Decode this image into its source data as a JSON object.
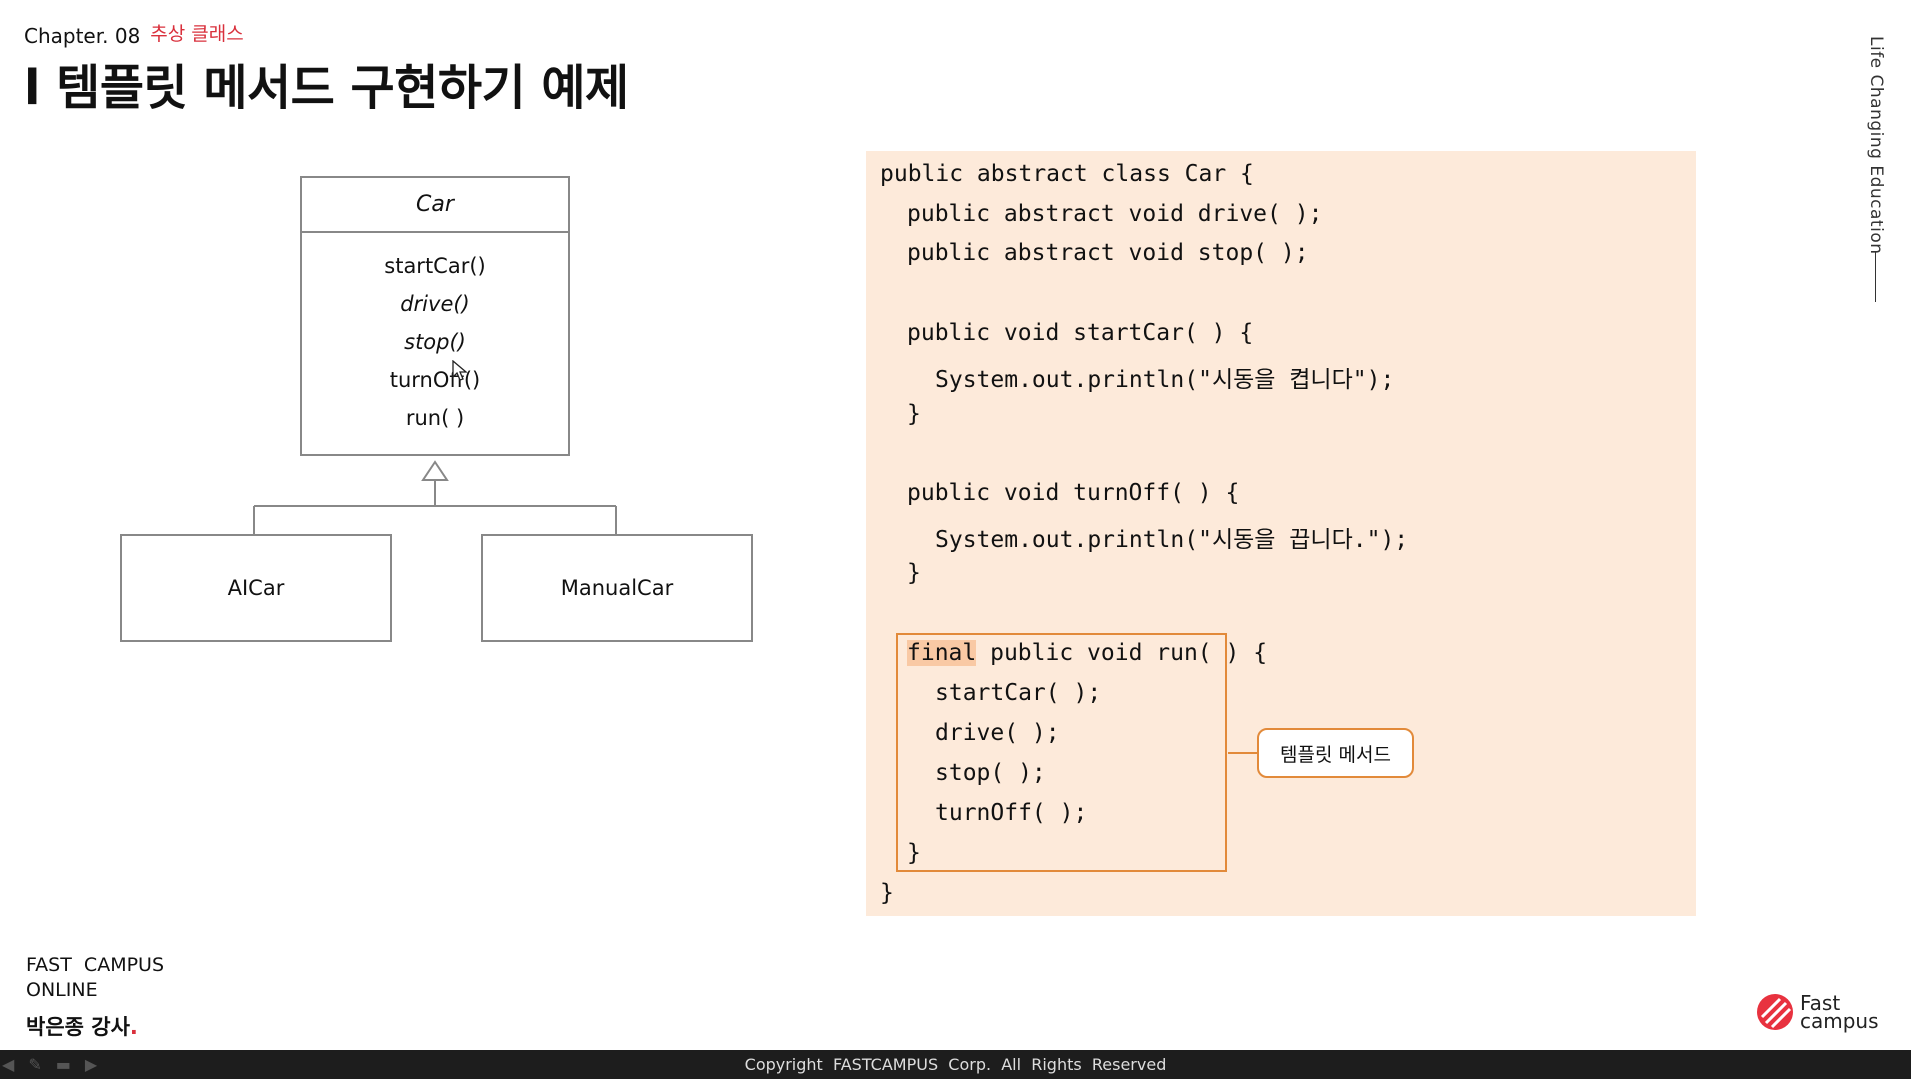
{
  "header": {
    "chapter": "Chapter. 08",
    "chapter_topic": "추상 클래스",
    "title": "l 템플릿 메서드 구현하기 예제",
    "side_text": "Life Changing Education"
  },
  "uml": {
    "class_name": "Car",
    "methods": [
      "startCar()",
      "drive()",
      "stop()",
      "turnOff()",
      "run( )"
    ],
    "subclasses": [
      "AICar",
      "ManualCar"
    ]
  },
  "code": {
    "lines": [
      "public abstract class Car {",
      "public abstract void drive( );",
      "public abstract void stop( );",
      "public void startCar( ) {",
      "System.out.println(\"시동을 켭니다\");",
      "}",
      "public void turnOff( ) {",
      "System.out.println(\"시동을 끕니다.\");",
      "}",
      "final",
      " public void run( ) {",
      "startCar( );",
      "drive( );",
      "stop( );",
      "turnOff( );",
      "}",
      "}"
    ],
    "callout": "템플릿 메서드"
  },
  "footer": {
    "brand_line1": "FAST  CAMPUS",
    "brand_line2": "ONLINE",
    "instructor": "박은종 강사",
    "instructor_dot": ".",
    "logo_line1": "Fast",
    "logo_line2": "campus",
    "copyright": "Copyright  FASTCAMPUS  Corp.  All  Rights  Reserved"
  },
  "colors": {
    "accent": "#d9303c",
    "code_bg": "#fdeada",
    "highlight_border": "#e28a3a"
  }
}
